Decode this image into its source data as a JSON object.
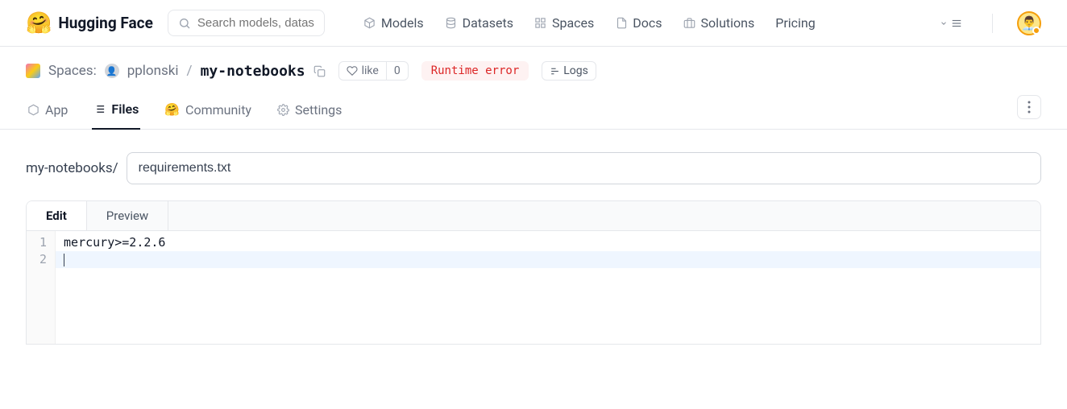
{
  "header": {
    "brand": "Hugging Face",
    "search_placeholder": "Search models, datasets, users...",
    "nav": {
      "models": "Models",
      "datasets": "Datasets",
      "spaces": "Spaces",
      "docs": "Docs",
      "solutions": "Solutions",
      "pricing": "Pricing"
    }
  },
  "breadcrumb": {
    "section": "Spaces:",
    "owner": "pplonski",
    "repo": "my-notebooks",
    "like_label": "like",
    "like_count": "0",
    "status": "Runtime error",
    "logs_label": "Logs"
  },
  "tabs": {
    "app": "App",
    "files": "Files",
    "community": "Community",
    "settings": "Settings"
  },
  "editor": {
    "path_root": "my-notebooks/",
    "filename": "requirements.txt",
    "tab_edit": "Edit",
    "tab_preview": "Preview",
    "lines": {
      "n1": "1",
      "n2": "2",
      "l1": "mercury>=2.2.6"
    }
  }
}
